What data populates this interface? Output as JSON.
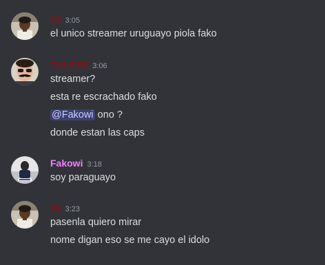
{
  "colors": {
    "background": "#313338",
    "text": "#dbdee1",
    "timestamp": "#949ba4",
    "user_red": "#8b0f12",
    "user_pink": "#f47fff",
    "mention_bg": "#3c4270",
    "mention_text": "#c9cdfb"
  },
  "messages": [
    {
      "username": "19",
      "time": "3:05",
      "lines": [
        "el unico streamer uruguayo piola fako"
      ]
    },
    {
      "username": "TULOS2",
      "time": "3:06",
      "lines": [
        "streamer?",
        "esta re escrachado fako"
      ],
      "mention_line": {
        "mention": "@Fakowi",
        "rest": " ono ?"
      },
      "lines_after": [
        "donde estan las caps"
      ]
    },
    {
      "username": "Fakowi",
      "time": "3:18",
      "lines": [
        "soy paraguayo"
      ]
    },
    {
      "username": "19",
      "time": "3:23",
      "lines": [
        "pasenla quiero mirar",
        "nome digan eso se me cayo el idolo"
      ]
    }
  ]
}
